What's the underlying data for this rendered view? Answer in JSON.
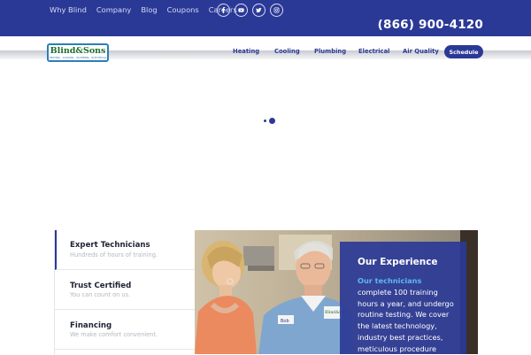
{
  "topbar": {
    "nav": [
      "Why Blind",
      "Company",
      "Blog",
      "Coupons",
      "Careers"
    ],
    "social_icons": [
      "facebook-icon",
      "youtube-icon",
      "twitter-icon",
      "instagram-icon"
    ],
    "phone": "(866) 900-4120"
  },
  "brand": {
    "logo_text": "Blind&Sons",
    "logo_tagline": "HEATING · COOLING · PLUMBING · ELECTRICAL"
  },
  "main_nav": {
    "items": [
      "Heating",
      "Cooling",
      "Plumbing",
      "Electrical",
      "Air Quality"
    ],
    "schedule_label": "Schedule"
  },
  "features": [
    {
      "title": "Expert Technicians",
      "subtitle": "Hundreds of hours of training."
    },
    {
      "title": "Trust Certified",
      "subtitle": "You can count on us."
    },
    {
      "title": "Financing",
      "subtitle": "We make comfort convenient."
    }
  ],
  "experience": {
    "title": "Our Experience",
    "highlight": "Our technicians",
    "lines": [
      "complete 100 training",
      "hours a year, and undergo",
      "routine testing. We cover",
      "the latest technology,",
      "industry best practices,",
      "meticulous procedure"
    ]
  },
  "photo": {
    "badge_name": "Bob",
    "badge_logo": "Blind&Sons"
  },
  "colors": {
    "brand_blue": "#2b3996",
    "highlight_blue": "#5fb7ef",
    "logo_green": "#1d6f2b"
  }
}
